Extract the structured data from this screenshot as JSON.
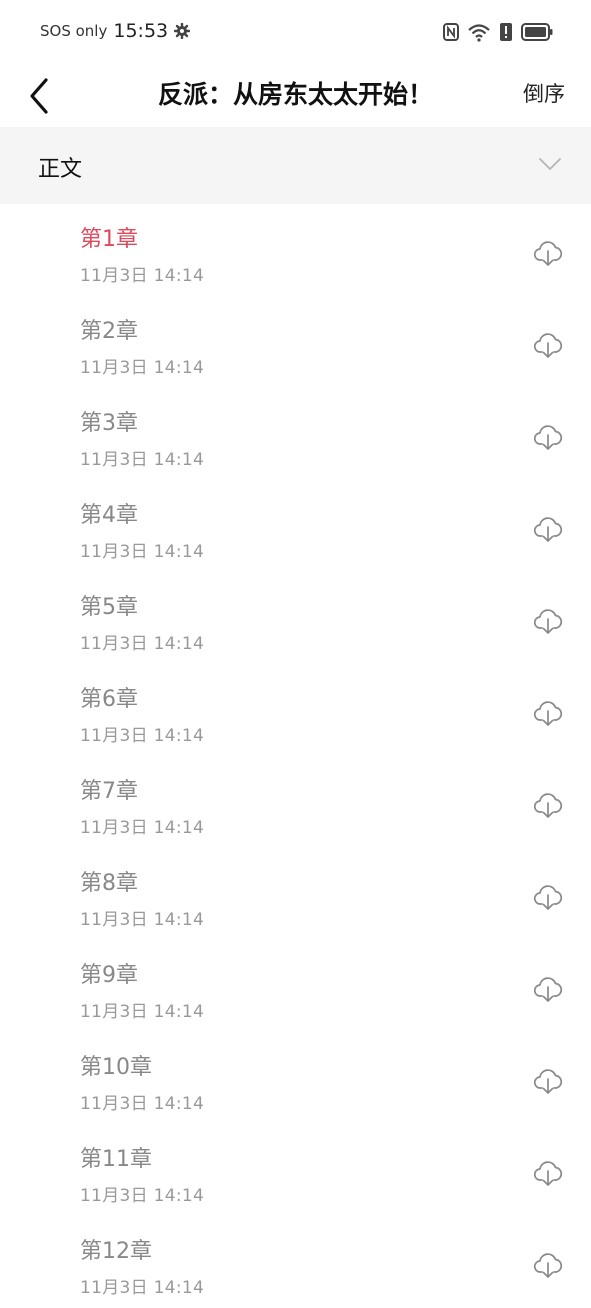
{
  "status_bar": {
    "carrier": "SOS only",
    "time": "15:53",
    "icons": [
      "gear-icon",
      "nfc-icon",
      "wifi-icon",
      "alert-icon",
      "battery-icon"
    ]
  },
  "header": {
    "title": "反派：从房东太太开始！",
    "sort_label": "倒序"
  },
  "section": {
    "label": "正文"
  },
  "colors": {
    "active_chapter": "#dc4a5c",
    "chapter_title": "#888888",
    "chapter_time": "#999999",
    "section_bg": "#f5f5f5"
  },
  "chapters": [
    {
      "title": "第1章",
      "time": "11月3日 14:14",
      "active": true
    },
    {
      "title": "第2章",
      "time": "11月3日 14:14",
      "active": false
    },
    {
      "title": "第3章",
      "time": "11月3日 14:14",
      "active": false
    },
    {
      "title": "第4章",
      "time": "11月3日 14:14",
      "active": false
    },
    {
      "title": "第5章",
      "time": "11月3日 14:14",
      "active": false
    },
    {
      "title": "第6章",
      "time": "11月3日 14:14",
      "active": false
    },
    {
      "title": "第7章",
      "time": "11月3日 14:14",
      "active": false
    },
    {
      "title": "第8章",
      "time": "11月3日 14:14",
      "active": false
    },
    {
      "title": "第9章",
      "time": "11月3日 14:14",
      "active": false
    },
    {
      "title": "第10章",
      "time": "11月3日 14:14",
      "active": false
    },
    {
      "title": "第11章",
      "time": "11月3日 14:14",
      "active": false
    },
    {
      "title": "第12章",
      "time": "11月3日 14:14",
      "active": false
    }
  ]
}
